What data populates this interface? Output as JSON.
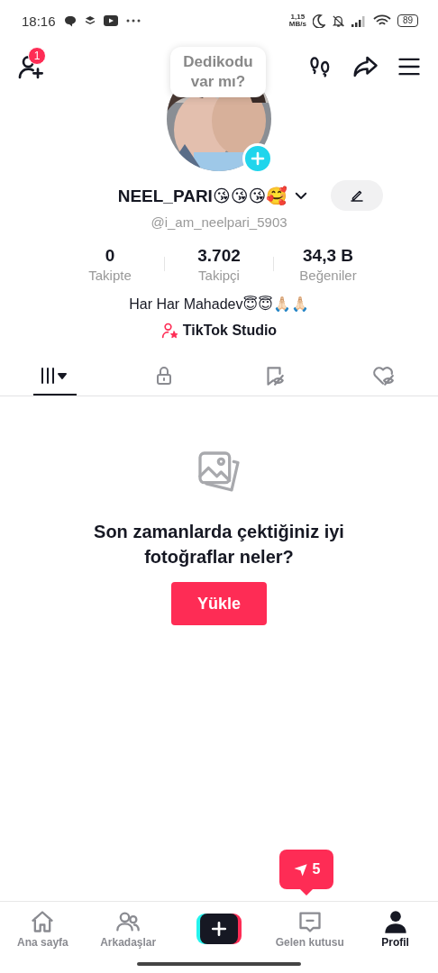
{
  "status_bar": {
    "time": "18:16",
    "speed_value": "1,15",
    "speed_unit": "MB/s",
    "battery": "89"
  },
  "top_bar": {
    "friend_badge": "1",
    "tooltip": "Dedikodu var mı?"
  },
  "profile": {
    "name": "NEEL_PARI😘😘😘🥰",
    "handle": "@i_am_neelpari_5903",
    "stats": [
      {
        "value": "0",
        "label": "Takipte"
      },
      {
        "value": "3.702",
        "label": "Takipçi"
      },
      {
        "value": "34,3 B",
        "label": "Beğeniler"
      }
    ],
    "bio": "Har Har Mahadev😇😇🙏🏻🙏🏻",
    "studio_link": "TikTok Studio"
  },
  "tabs": [
    {
      "kind": "videos",
      "selected": true
    },
    {
      "kind": "private",
      "selected": false
    },
    {
      "kind": "saved",
      "selected": false
    },
    {
      "kind": "liked",
      "selected": false
    }
  ],
  "empty_state": {
    "message": "Son zamanlarda çektiğiniz iyi fotoğraflar neler?",
    "button": "Yükle"
  },
  "toast": {
    "count": "5"
  },
  "nav": [
    {
      "kind": "home",
      "label": "Ana sayfa",
      "selected": false
    },
    {
      "kind": "friends",
      "label": "Arkadaşlar",
      "selected": false
    },
    {
      "kind": "create",
      "selected": false
    },
    {
      "kind": "inbox",
      "label": "Gelen kutusu",
      "selected": false
    },
    {
      "kind": "profile",
      "label": "Profil",
      "selected": true
    }
  ]
}
